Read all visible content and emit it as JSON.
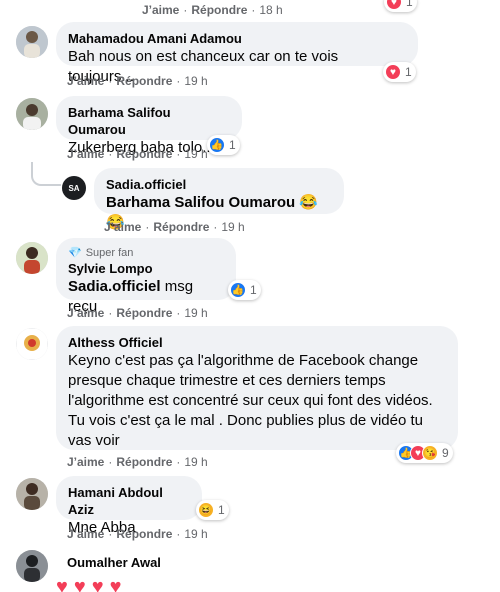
{
  "actions": {
    "like": "J’aime",
    "reply": "Répondre",
    "sep": "·"
  },
  "comments": [
    {
      "name": "",
      "text": "",
      "time": "18 h",
      "reaction_count": "1"
    },
    {
      "name": "Mahamadou Amani Adamou",
      "text": "Bah nous on est chanceux car on te vois toujours...",
      "time": "19 h",
      "reaction_count": "1"
    },
    {
      "name": "Barhama Salifou Oumarou",
      "text": "Zukerberg baba tolo...",
      "time": "19 h",
      "reaction_count": "1"
    },
    {
      "name": "Sadia.officiel",
      "tag": "Barhama Salifou Oumarou",
      "emoji": "😂😂",
      "time": "19 h"
    },
    {
      "badge": "Super fan",
      "name": "Sylvie Lompo",
      "tag": "Sadia.officiel",
      "text": "msg reçu",
      "time": "19 h",
      "reaction_count": "1"
    },
    {
      "name": "Althess Officiel",
      "text": "Keyno c'est pas ça l'algorithme de Facebook change presque chaque trimestre et ces derniers temps l'algorithme est concentré sur ceux qui font des vidéos. Tu vois c'est ça le mal . Donc publies plus de vidéo tu vas voir",
      "time": "19 h",
      "reaction_count": "9"
    },
    {
      "name": "Hamani Abdoul Aziz",
      "text": "Mne Abba",
      "time": "19 h",
      "reaction_count": "1"
    },
    {
      "name": "Oumalher Awal"
    }
  ],
  "colors": {
    "like": "#1877f2",
    "love": "#f33e58",
    "haha": "#f7b125",
    "bubble": "#f0f2f5",
    "meta": "#65676b"
  }
}
